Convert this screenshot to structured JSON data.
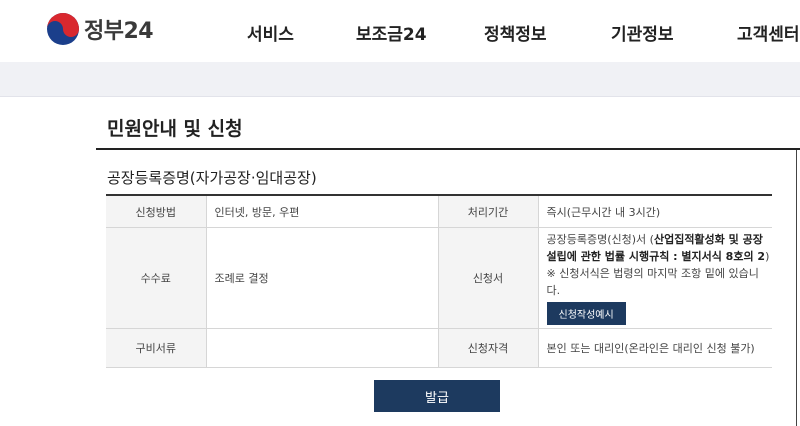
{
  "header": {
    "logo_text": "정부24",
    "nav": [
      "서비스",
      "보조금24",
      "정책정보",
      "기관정보",
      "고객센터"
    ]
  },
  "page": {
    "title": "민원안내 및 신청",
    "section_title": "공장등록증명(자가공장·임대공장)"
  },
  "table": {
    "method_label": "신청방법",
    "method_value": "인터넷, 방문, 우편",
    "period_label": "처리기간",
    "period_value": "즉시(근무시간 내 3시간)",
    "fee_label": "수수료",
    "fee_value": "조례로 결정",
    "form_label": "신청서",
    "form_name": "공장등록증명(신청)서 (",
    "form_bold": "산업집적활성화 및 공장설립에 관한 법률 시행규칙 : 별지서식 8호의 2",
    "form_close": ")",
    "form_note": "※ 신청서식은 법령의 마지막 조항 밑에 있습니다.",
    "example_button": "신청작성예시",
    "docs_label": "구비서류",
    "docs_value": "",
    "qual_label": "신청자격",
    "qual_value": "본인 또는 대리인(온라인은 대리인 신청 불가)"
  },
  "actions": {
    "issue_button": "발급"
  },
  "colors": {
    "primary": "#1d3a5f",
    "logo_red": "#d9282f",
    "logo_blue": "#1b3f8b"
  }
}
